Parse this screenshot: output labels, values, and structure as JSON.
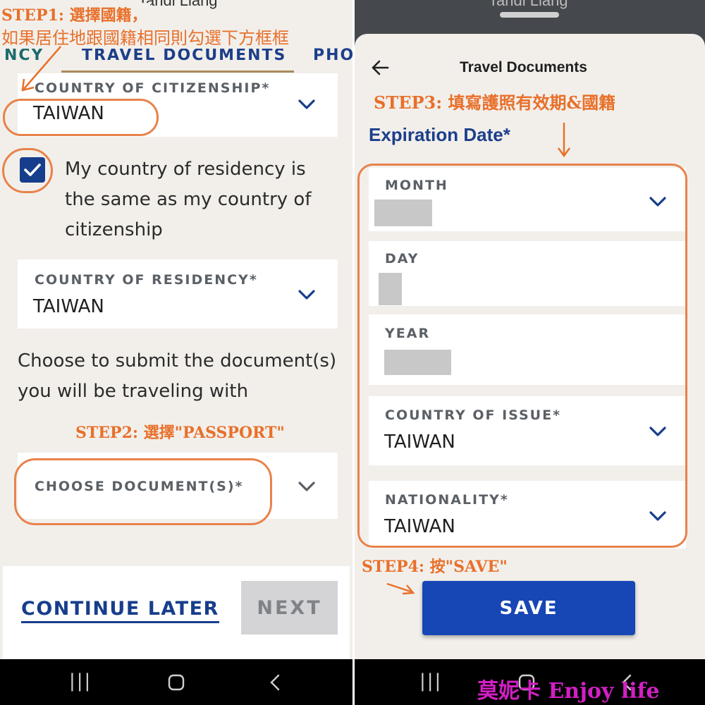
{
  "left": {
    "top_cut_name": "Tandi Liang",
    "tabs": [
      {
        "label": "NCY"
      },
      {
        "label": "TRAVEL DOCUMENTS"
      },
      {
        "label": "PHO"
      }
    ],
    "citizenship": {
      "label": "COUNTRY OF CITIZENSHIP*",
      "value": "TAIWAN"
    },
    "same_as_checkbox": {
      "checked": true,
      "label": "My country of residency is the same as my country of citizenship"
    },
    "residency": {
      "label": "COUNTRY OF RESIDENCY*",
      "value": "TAIWAN"
    },
    "choose_text": "Choose to submit the document(s) you will be traveling with",
    "document": {
      "label": "CHOOSE DOCUMENT(S)*",
      "value": ""
    },
    "continue_later": "CONTINUE LATER",
    "next": "NEXT"
  },
  "right": {
    "top_cut_name": "Tandi Liang",
    "title": "Travel Documents",
    "expiration_label": "Expiration Date*",
    "month": {
      "label": "MONTH"
    },
    "day": {
      "label": "DAY"
    },
    "year": {
      "label": "YEAR"
    },
    "country_of_issue": {
      "label": "COUNTRY OF ISSUE*",
      "value": "TAIWAN"
    },
    "nationality": {
      "label": "NATIONALITY*",
      "value": "TAIWAN"
    },
    "save": "SAVE"
  },
  "annotations": {
    "step1_title": "STEP1: 選擇國籍，",
    "step1_sub": "如果居住地跟國籍相同則勾選下方框框",
    "step2": "STEP2: 選擇\"PASSPORT\"",
    "step3": "STEP3: 填寫護照有效期&國籍",
    "step4": "STEP4: 按\"SAVE\""
  },
  "watermark": "莫妮卡 Enjoy life",
  "colors": {
    "primary_blue": "#173e8c",
    "save_blue": "#1747b4",
    "annotation_orange": "#e8702a",
    "background": "#f2efeb"
  }
}
